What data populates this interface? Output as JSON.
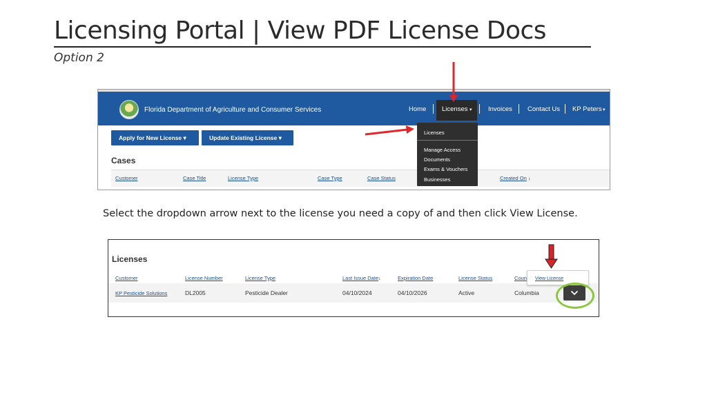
{
  "slide": {
    "title": "Licensing Portal | View PDF License Docs",
    "subtitle": "Option 2",
    "instruction": "Select the dropdown arrow next to the license you need a copy of and then click View License."
  },
  "portal": {
    "org_name": "Florida Department of Agriculture and Consumer Services",
    "nav": {
      "home": "Home",
      "licenses": "Licenses",
      "invoices": "Invoices",
      "contact": "Contact Us",
      "user": "KP Peters"
    },
    "licenses_menu": [
      "Licenses",
      "Manage Access",
      "Documents",
      "Exams & Vouchers",
      "Businesses"
    ],
    "buttons": {
      "apply": "Apply for New License",
      "update": "Update Existing License"
    },
    "cases": {
      "heading": "Cases",
      "columns": [
        "Customer",
        "Case Title",
        "License Type",
        "Case Type",
        "Case Status",
        "Created On"
      ]
    }
  },
  "licenses_table": {
    "heading": "Licenses",
    "columns": [
      "Customer",
      "License Number",
      "License Type",
      "Last Issue Date",
      "Expiration Date",
      "License Status",
      "Coun"
    ],
    "row": {
      "customer": "KP Pesticide Solutions",
      "license_number": "DL2005",
      "license_type": "Pesticide Dealer",
      "last_issue_date": "04/10/2024",
      "expiration_date": "04/10/2026",
      "license_status": "Active",
      "county": "Columbia"
    },
    "row_action": "View License"
  },
  "colors": {
    "nav_blue": "#1f5aa0",
    "dropdown_dark": "#2f2f2f",
    "highlight_arrow": "#e0262b",
    "highlight_ring": "#8cc63f"
  },
  "icons": [
    "caret-down-icon",
    "sort-down-arrow-icon",
    "chevron-down-icon",
    "red-pointer-arrow-icon",
    "seal-logo"
  ]
}
